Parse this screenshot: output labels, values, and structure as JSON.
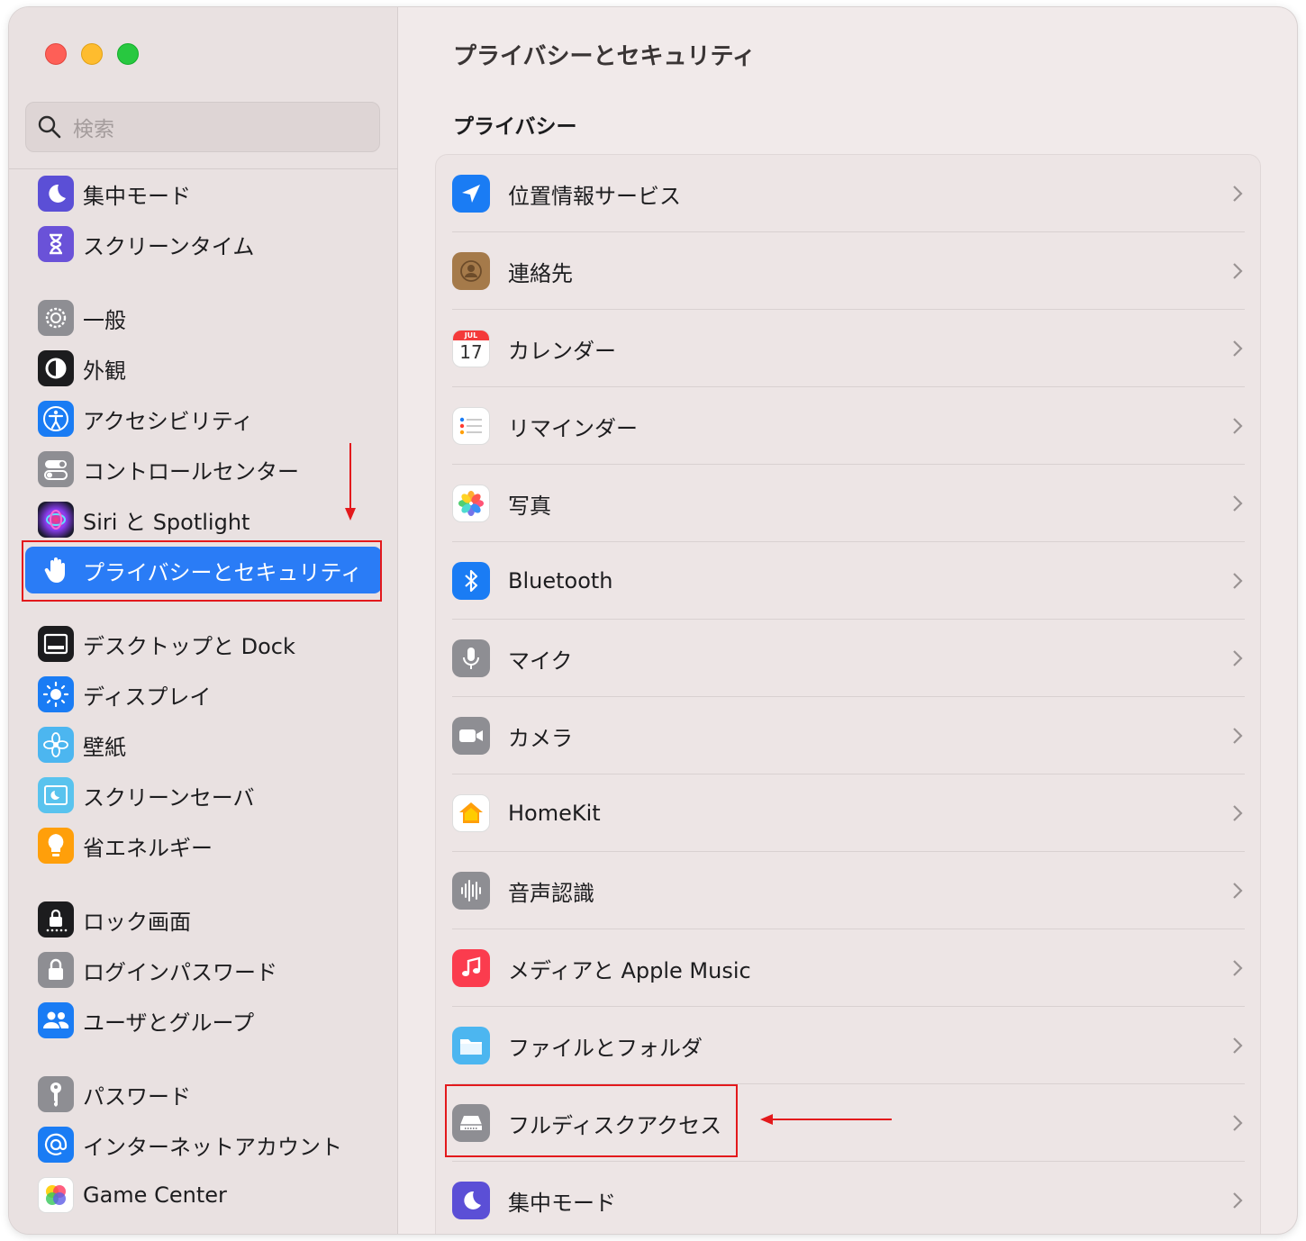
{
  "sidebar": {
    "search_placeholder": "検索",
    "items": [
      {
        "label": "集中モード",
        "icon": "moon-icon"
      },
      {
        "label": "スクリーンタイム",
        "icon": "hourglass-icon"
      },
      {
        "label": "一般",
        "icon": "gear-icon"
      },
      {
        "label": "外観",
        "icon": "appearance-icon"
      },
      {
        "label": "アクセシビリティ",
        "icon": "accessibility-icon"
      },
      {
        "label": "コントロールセンター",
        "icon": "toggles-icon"
      },
      {
        "label": "Siri と Spotlight",
        "icon": "siri-icon"
      },
      {
        "label": "プライバシーとセキュリティ",
        "icon": "hand-icon",
        "selected": true
      },
      {
        "label": "デスクトップと Dock",
        "icon": "dock-icon"
      },
      {
        "label": "ディスプレイ",
        "icon": "sun-icon"
      },
      {
        "label": "壁紙",
        "icon": "flower-icon"
      },
      {
        "label": "スクリーンセーバ",
        "icon": "screensaver-icon"
      },
      {
        "label": "省エネルギー",
        "icon": "bulb-icon"
      },
      {
        "label": "ロック画面",
        "icon": "lock-screen-icon"
      },
      {
        "label": "ログインパスワード",
        "icon": "lock-icon"
      },
      {
        "label": "ユーザとグループ",
        "icon": "users-icon"
      },
      {
        "label": "パスワード",
        "icon": "key-icon"
      },
      {
        "label": "インターネットアカウント",
        "icon": "at-icon"
      },
      {
        "label": "Game Center",
        "icon": "game-center-icon"
      }
    ]
  },
  "main": {
    "title": "プライバシーとセキュリティ",
    "section_title": "プライバシー",
    "calendar_icon": {
      "month": "JUL",
      "day": "17"
    },
    "rows": [
      {
        "label": "位置情報サービス",
        "icon": "location-arrow-icon"
      },
      {
        "label": "連絡先",
        "icon": "contacts-icon"
      },
      {
        "label": "カレンダー",
        "icon": "calendar-icon"
      },
      {
        "label": "リマインダー",
        "icon": "reminders-icon"
      },
      {
        "label": "写真",
        "icon": "photos-icon"
      },
      {
        "label": "Bluetooth",
        "icon": "bluetooth-icon"
      },
      {
        "label": "マイク",
        "icon": "microphone-icon"
      },
      {
        "label": "カメラ",
        "icon": "camera-icon"
      },
      {
        "label": "HomeKit",
        "icon": "home-icon"
      },
      {
        "label": "音声認識",
        "icon": "waveform-icon"
      },
      {
        "label": "メディアと Apple Music",
        "icon": "music-icon"
      },
      {
        "label": "ファイルとフォルダ",
        "icon": "folder-icon"
      },
      {
        "label": "フルディスクアクセス",
        "icon": "disk-icon",
        "highlighted": true
      },
      {
        "label": "集中モード",
        "icon": "moon-icon"
      }
    ]
  },
  "colors": {
    "accent": "#2a7cf6",
    "annotation": "#e3191c",
    "sidebar_bg": "#e9e1e1",
    "content_bg": "#f1eaea"
  }
}
